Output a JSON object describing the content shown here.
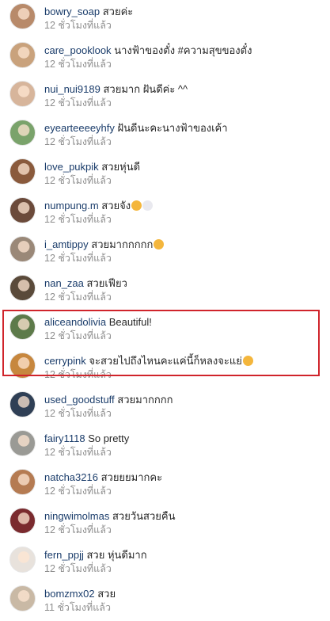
{
  "comments": [
    {
      "username": "bowry_soap",
      "text": "สวยค่ะ",
      "time": "12 ชั่วโมงที่แล้ว",
      "avatar_color": "#b88a6a",
      "emoji": ""
    },
    {
      "username": "care_pooklook",
      "text": "นางฟ้าของตั๋ง #ความสุขของตั๋ง",
      "time": "12 ชั่วโมงที่แล้ว",
      "avatar_color": "#c9a27c",
      "emoji": ""
    },
    {
      "username": "nui_nui9189",
      "text": "สวยมาก ฝันดีค่ะ ^^",
      "time": "12 ชั่วโมงที่แล้ว",
      "avatar_color": "#d7b59b",
      "emoji": ""
    },
    {
      "username": "eyearteeeeyhfy",
      "text": "ฝันดีนะคะนางฟ้าของเค้า",
      "time": "12 ชั่วโมงที่แล้ว",
      "avatar_color": "#7aa36b",
      "emoji": ""
    },
    {
      "username": "love_pukpik",
      "text": "สวยหุ่นดี",
      "time": "12 ชั่วโมงที่แล้ว",
      "avatar_color": "#8a5a3c",
      "emoji": ""
    },
    {
      "username": "numpung.m",
      "text": "สวยจัง",
      "time": "12 ชั่วโมงที่แล้ว",
      "avatar_color": "#6b4a3a",
      "emoji": "smile-hearts-icon cat-icon"
    },
    {
      "username": "i_amtippy",
      "text": "สวยมากกกกก",
      "time": "12 ชั่วโมงที่แล้ว",
      "avatar_color": "#9a8878",
      "emoji": "smile-hearts-icon"
    },
    {
      "username": "nan_zaa",
      "text": "สวยเฟียว",
      "time": "12 ชั่วโมงที่แล้ว",
      "avatar_color": "#5a4a3a",
      "emoji": ""
    },
    {
      "username": "aliceandolivia",
      "text": "Beautiful!",
      "time": "12 ชั่วโมงที่แล้ว",
      "avatar_color": "#5d7a4a",
      "emoji": ""
    },
    {
      "username": "cerrypink",
      "text": "จะสวยไปถึงไหนคะแค่นี้ก็หลงจะแย่",
      "time": "12 ชั่วโมงที่แล้ว",
      "avatar_color": "#c7873e",
      "emoji": "smile-hearts-icon"
    },
    {
      "username": "used_goodstuff",
      "text": "สวยมากกกก",
      "time": "12 ชั่วโมงที่แล้ว",
      "avatar_color": "#2f3f55",
      "emoji": ""
    },
    {
      "username": "fairy1118",
      "text": "So pretty",
      "time": "12 ชั่วโมงที่แล้ว",
      "avatar_color": "#9a9a95",
      "emoji": ""
    },
    {
      "username": "natcha3216",
      "text": "สวยยยมากคะ",
      "time": "12 ชั่วโมงที่แล้ว",
      "avatar_color": "#b57b52",
      "emoji": ""
    },
    {
      "username": "ningwimolmas",
      "text": "สวยวันสวยคืน",
      "time": "12 ชั่วโมงที่แล้ว",
      "avatar_color": "#7a2a2e",
      "emoji": ""
    },
    {
      "username": "fern_ppjj",
      "text": "สวย หุ่นดีมาก",
      "time": "12 ชั่วโมงที่แล้ว",
      "avatar_color": "#e8e2dc",
      "emoji": ""
    },
    {
      "username": "bomzmx02",
      "text": "สวย",
      "time": "11 ชั่วโมงที่แล้ว",
      "avatar_color": "#c9b9a5",
      "emoji": ""
    }
  ],
  "highlight_color": "#d0242b"
}
